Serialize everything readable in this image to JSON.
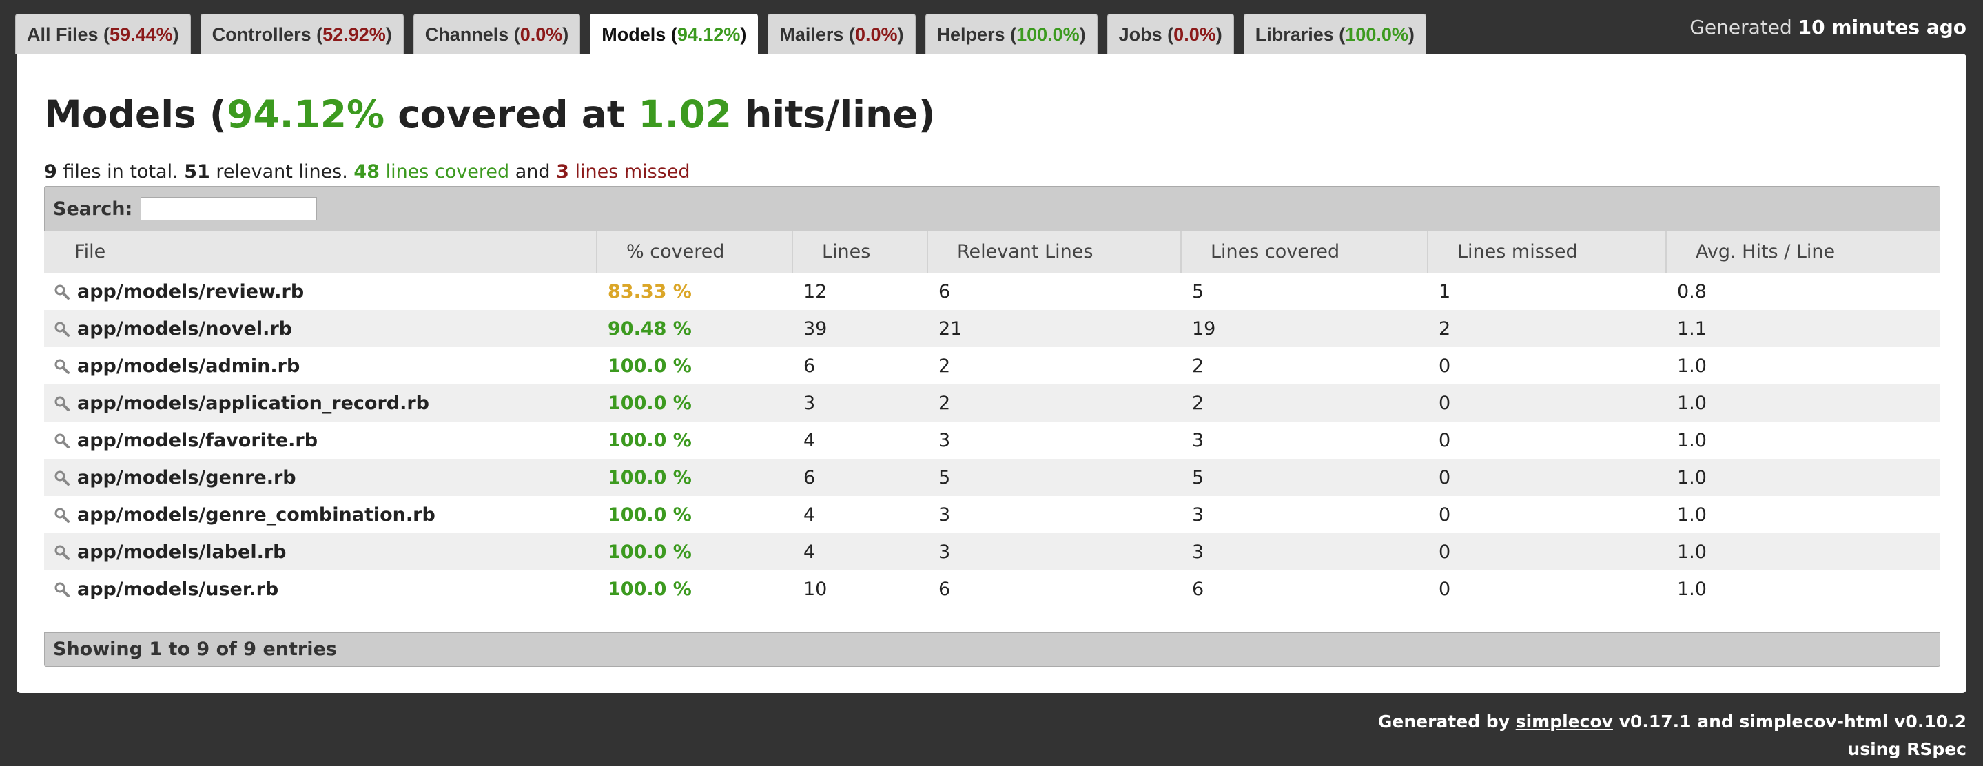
{
  "tabs": [
    {
      "name": "All Files",
      "pct": "59.44%",
      "color": "#8b1a1a"
    },
    {
      "name": "Controllers",
      "pct": "52.92%",
      "color": "#8b1a1a"
    },
    {
      "name": "Channels",
      "pct": "0.0%",
      "color": "#8b1a1a"
    },
    {
      "name": "Models",
      "pct": "94.12%",
      "color": "#3c9a1f",
      "active": true
    },
    {
      "name": "Mailers",
      "pct": "0.0%",
      "color": "#8b1a1a"
    },
    {
      "name": "Helpers",
      "pct": "100.0%",
      "color": "#3c9a1f"
    },
    {
      "name": "Jobs",
      "pct": "0.0%",
      "color": "#8b1a1a"
    },
    {
      "name": "Libraries",
      "pct": "100.0%",
      "color": "#3c9a1f"
    }
  ],
  "header": {
    "generated_prefix": "Generated",
    "generated_time": "10 minutes ago"
  },
  "title": {
    "name": "Models",
    "open": " (",
    "pct": "94.12%",
    "middle": " covered at ",
    "hits": "1.02",
    "suffix": " hits/line)"
  },
  "summary": {
    "files": "9",
    "files_text": " files in total. ",
    "relevant": "51",
    "relevant_text": " relevant lines. ",
    "covered": "48",
    "covered_text": " lines covered",
    "and_text": " and ",
    "missed": "3",
    "missed_text": " lines missed"
  },
  "search": {
    "label": "Search:",
    "value": ""
  },
  "columns": [
    "File",
    "% covered",
    "Lines",
    "Relevant Lines",
    "Lines covered",
    "Lines missed",
    "Avg. Hits / Line"
  ],
  "rows": [
    {
      "file": "app/models/review.rb",
      "pct": "83.33 %",
      "lines": "12",
      "relevant": "6",
      "covered": "5",
      "missed": "1",
      "avg": "0.8",
      "color": "#dba628"
    },
    {
      "file": "app/models/novel.rb",
      "pct": "90.48 %",
      "lines": "39",
      "relevant": "21",
      "covered": "19",
      "missed": "2",
      "avg": "1.1",
      "color": "#3c9a1f"
    },
    {
      "file": "app/models/admin.rb",
      "pct": "100.0 %",
      "lines": "6",
      "relevant": "2",
      "covered": "2",
      "missed": "0",
      "avg": "1.0",
      "color": "#3c9a1f"
    },
    {
      "file": "app/models/application_record.rb",
      "pct": "100.0 %",
      "lines": "3",
      "relevant": "2",
      "covered": "2",
      "missed": "0",
      "avg": "1.0",
      "color": "#3c9a1f"
    },
    {
      "file": "app/models/favorite.rb",
      "pct": "100.0 %",
      "lines": "4",
      "relevant": "3",
      "covered": "3",
      "missed": "0",
      "avg": "1.0",
      "color": "#3c9a1f"
    },
    {
      "file": "app/models/genre.rb",
      "pct": "100.0 %",
      "lines": "6",
      "relevant": "5",
      "covered": "5",
      "missed": "0",
      "avg": "1.0",
      "color": "#3c9a1f"
    },
    {
      "file": "app/models/genre_combination.rb",
      "pct": "100.0 %",
      "lines": "4",
      "relevant": "3",
      "covered": "3",
      "missed": "0",
      "avg": "1.0",
      "color": "#3c9a1f"
    },
    {
      "file": "app/models/label.rb",
      "pct": "100.0 %",
      "lines": "4",
      "relevant": "3",
      "covered": "3",
      "missed": "0",
      "avg": "1.0",
      "color": "#3c9a1f"
    },
    {
      "file": "app/models/user.rb",
      "pct": "100.0 %",
      "lines": "10",
      "relevant": "6",
      "covered": "6",
      "missed": "0",
      "avg": "1.0",
      "color": "#3c9a1f"
    }
  ],
  "footer": {
    "showing": "Showing 1 to 9 of 9 entries"
  },
  "credits": {
    "prefix": "Generated by ",
    "link": "simplecov",
    "middle": " v0.17.1 and simplecov-html v0.10.2",
    "line2": "using RSpec"
  },
  "icons": {
    "file_search": "magnifier-icon"
  }
}
